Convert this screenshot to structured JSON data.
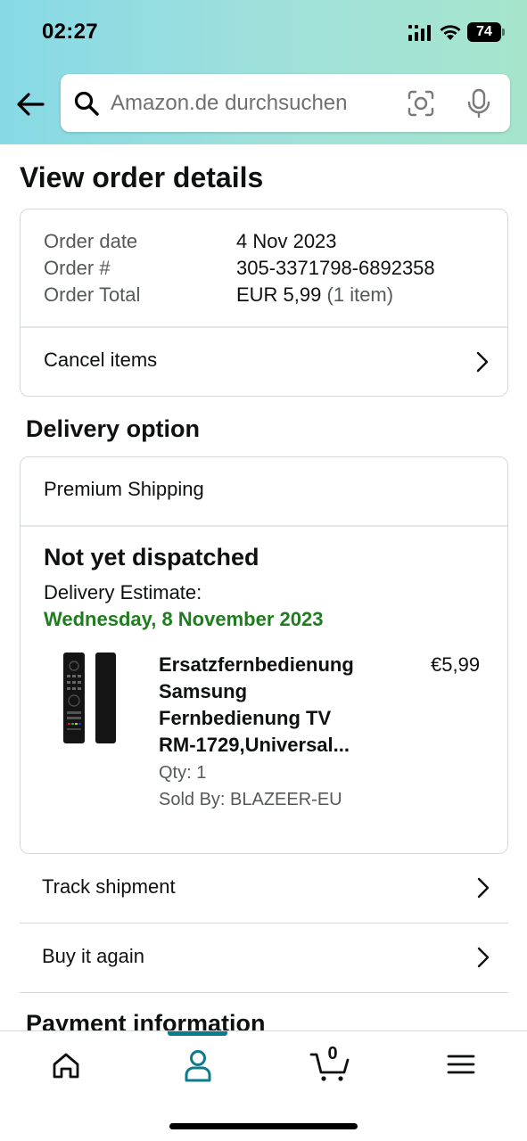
{
  "status_bar": {
    "time": "02:27",
    "battery": "74",
    "icons": [
      "signal-icon",
      "wifi-icon",
      "battery-icon"
    ]
  },
  "search": {
    "placeholder": "Amazon.de durchsuchen",
    "icons": [
      "back-arrow-icon",
      "search-icon",
      "camera-scan-icon",
      "microphone-icon"
    ]
  },
  "page_title": "View order details",
  "order_summary": {
    "date_label": "Order date",
    "date_value": "4 Nov 2023",
    "number_label": "Order #",
    "number_value": "305-3371798-6892358",
    "total_label": "Order Total",
    "total_value": "EUR 5,99",
    "total_items": "(1 item)",
    "cancel_label": "Cancel items"
  },
  "delivery": {
    "section_title": "Delivery option",
    "shipping_method": "Premium Shipping",
    "status": "Not yet dispatched",
    "estimate_label": "Delivery Estimate:",
    "estimate_date": "Wednesday, 8 November 2023",
    "estimate_color": "#1e7d1e",
    "product": {
      "title": "Ersatzfernbedienung Samsung Fernbedienung TV RM-1729,Universal...",
      "price": "€5,99",
      "qty": "Qty: 1",
      "seller": "Sold By: BLAZEER-EU"
    }
  },
  "actions": {
    "track_label": "Track shipment",
    "buy_again_label": "Buy it again"
  },
  "payment_title": "Payment information",
  "bottom_nav": {
    "active_color": "#0c7c8c",
    "cart_count": "0",
    "items": [
      "home-icon",
      "account-icon",
      "cart-icon",
      "menu-icon"
    ]
  }
}
